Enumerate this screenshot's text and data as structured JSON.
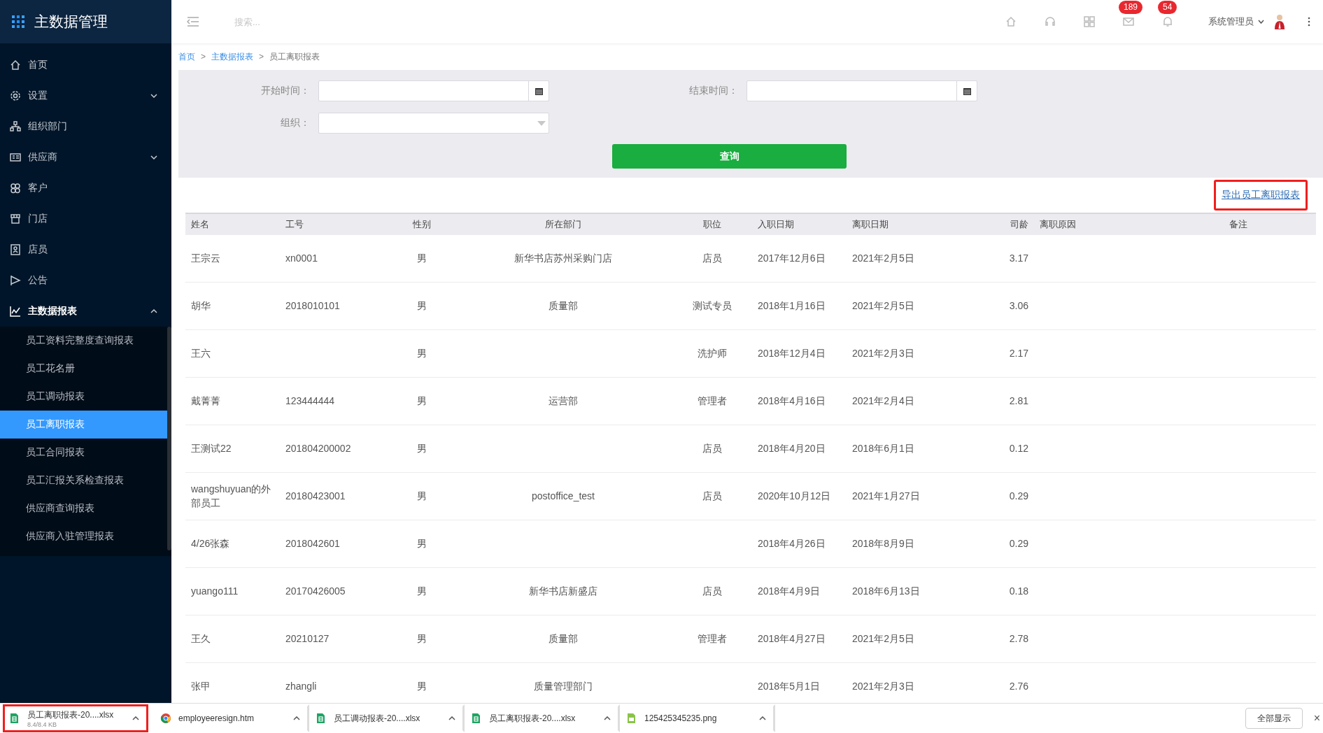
{
  "app": {
    "title": "主数据管理"
  },
  "sidebar": {
    "items": [
      {
        "label": "首页",
        "kind": "link",
        "selected": false
      },
      {
        "label": "设置",
        "kind": "group",
        "selected": false,
        "expanded": false
      },
      {
        "label": "组织部门",
        "kind": "link",
        "selected": false
      },
      {
        "label": "供应商",
        "kind": "group",
        "selected": false,
        "expanded": false
      },
      {
        "label": "客户",
        "kind": "link",
        "selected": false
      },
      {
        "label": "门店",
        "kind": "link",
        "selected": false
      },
      {
        "label": "店员",
        "kind": "link",
        "selected": false
      },
      {
        "label": "公告",
        "kind": "link",
        "selected": false
      },
      {
        "label": "主数据报表",
        "kind": "group",
        "selected": true,
        "expanded": true,
        "children": [
          {
            "label": "员工资料完整度查询报表",
            "selected": false
          },
          {
            "label": "员工花名册",
            "selected": false
          },
          {
            "label": "员工调动报表",
            "selected": false
          },
          {
            "label": "员工离职报表",
            "selected": true
          },
          {
            "label": "员工合同报表",
            "selected": false
          },
          {
            "label": "员工汇报关系检查报表",
            "selected": false
          },
          {
            "label": "供应商查询报表",
            "selected": false
          },
          {
            "label": "供应商入驻管理报表",
            "selected": false
          }
        ]
      }
    ]
  },
  "topbar": {
    "search": {
      "placeholder": "搜索..."
    },
    "badges": [
      {
        "count": "189"
      },
      {
        "count": "54"
      }
    ],
    "user": "系统管理员"
  },
  "breadcrumb": [
    {
      "label": "首页",
      "current": false,
      "separator": ">"
    },
    {
      "label": "主数据报表",
      "current": false,
      "separator": ">"
    },
    {
      "label": "员工离职报表",
      "current": true
    }
  ],
  "filters": {
    "fields": [
      {
        "label": "开始时间：",
        "kind": "date"
      },
      {
        "label": "结束时间：",
        "kind": "date"
      },
      {
        "label": "组织：",
        "kind": "select"
      }
    ],
    "button": "查询"
  },
  "export_link": {
    "label": "导出员工离职报表",
    "highlighted": true
  },
  "table": {
    "columns": [
      "姓名",
      "工号",
      "性别",
      "所在部门",
      "职位",
      "入职日期",
      "离职日期",
      "司龄",
      "离职原因",
      "备注"
    ],
    "rows": [
      [
        "王宗云",
        "xn0001",
        "男",
        "新华书店苏州采购门店",
        "店员",
        "2017年12月6日",
        "2021年2月5日",
        "3.17"
      ],
      [
        "胡华",
        "2018010101",
        "男",
        "质量部",
        "测试专员",
        "2018年1月16日",
        "2021年2月5日",
        "3.06"
      ],
      [
        "王六",
        "",
        "男",
        "",
        "洗护师",
        "2018年12月4日",
        "2021年2月3日",
        "2.17"
      ],
      [
        "戴菁菁",
        "123444444",
        "男",
        "运营部",
        "管理者",
        "2018年4月16日",
        "2021年2月4日",
        "2.81"
      ],
      [
        "王测试22",
        "201804200002",
        "男",
        "",
        "店员",
        "2018年4月20日",
        "2018年6月1日",
        "0.12"
      ],
      [
        "wangshuyuan的外部员工",
        "20180423001",
        "男",
        "postoffice_test",
        "店员",
        "2020年10月12日",
        "2021年1月27日",
        "0.29"
      ],
      [
        "4/26张森",
        "2018042601",
        "男",
        "",
        "",
        "2018年4月26日",
        "2018年8月9日",
        "0.29"
      ],
      [
        "yuango111",
        "20170426005",
        "男",
        "新华书店新盛店",
        "店员",
        "2018年4月9日",
        "2018年6月13日",
        "0.18"
      ],
      [
        "王久",
        "20210127",
        "男",
        "质量部",
        "管理者",
        "2018年4月27日",
        "2021年2月5日",
        "2.78"
      ],
      [
        "张甲",
        "zhangli",
        "男",
        "质量管理部门",
        "",
        "2018年5月1日",
        "2021年2月3日",
        "2.76"
      ]
    ]
  },
  "downloads": {
    "items": [
      {
        "name": "员工离职报表-20....xlsx",
        "size": "8.4/8.4 KB",
        "kind": "xlsx",
        "highlighted": true
      },
      {
        "name": "employeeresign.htm",
        "kind": "htm",
        "highlighted": false
      },
      {
        "name": "员工调动报表-20....xlsx",
        "kind": "xlsx",
        "highlighted": false
      },
      {
        "name": "员工离职报表-20....xlsx",
        "kind": "xlsx",
        "highlighted": false
      },
      {
        "name": "125425345235.png",
        "kind": "png",
        "highlighted": false
      }
    ],
    "show_all": "全部显示",
    "close": "×"
  }
}
